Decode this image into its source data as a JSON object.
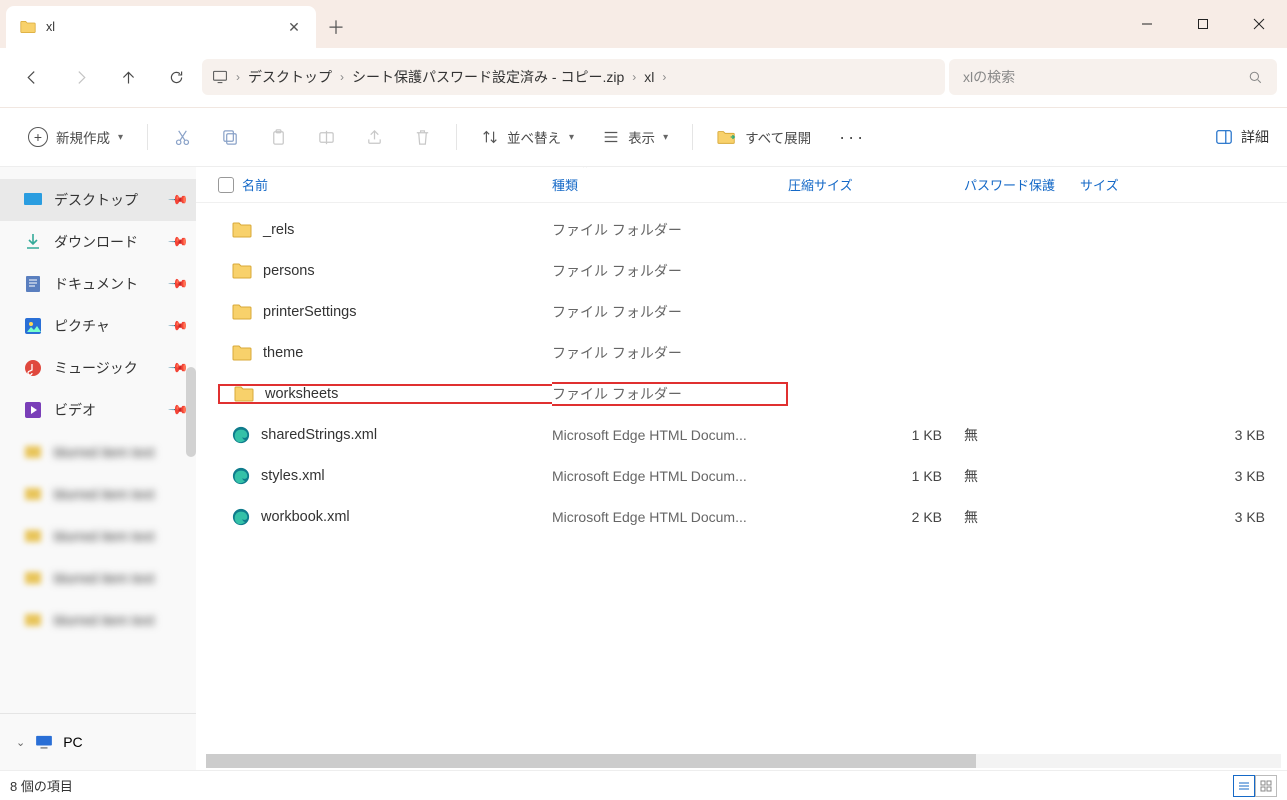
{
  "tab": {
    "title": "xl"
  },
  "breadcrumb": {
    "seg1": "デスクトップ",
    "seg2": "シート保護パスワード設定済み - コピー.zip",
    "seg3": "xl"
  },
  "search": {
    "placeholder": "xlの検索"
  },
  "toolbar": {
    "new": "新規作成",
    "sort": "並べ替え",
    "view": "表示",
    "extract_all": "すべて展開",
    "details": "詳細"
  },
  "sidebar": {
    "items": [
      {
        "label": "デスクトップ"
      },
      {
        "label": "ダウンロード"
      },
      {
        "label": "ドキュメント"
      },
      {
        "label": "ピクチャ"
      },
      {
        "label": "ミュージック"
      },
      {
        "label": "ビデオ"
      }
    ],
    "pc_label": "PC"
  },
  "columns": {
    "name": "名前",
    "type": "種類",
    "csize": "圧縮サイズ",
    "pw": "パスワード保護",
    "size": "サイズ"
  },
  "rows": [
    {
      "name": "_rels",
      "type": "ファイル フォルダー",
      "csize": "",
      "pw": "",
      "size": "",
      "icon": "folder"
    },
    {
      "name": "persons",
      "type": "ファイル フォルダー",
      "csize": "",
      "pw": "",
      "size": "",
      "icon": "folder"
    },
    {
      "name": "printerSettings",
      "type": "ファイル フォルダー",
      "csize": "",
      "pw": "",
      "size": "",
      "icon": "folder"
    },
    {
      "name": "theme",
      "type": "ファイル フォルダー",
      "csize": "",
      "pw": "",
      "size": "",
      "icon": "folder"
    },
    {
      "name": "worksheets",
      "type": "ファイル フォルダー",
      "csize": "",
      "pw": "",
      "size": "",
      "icon": "folder",
      "highlight": true
    },
    {
      "name": "sharedStrings.xml",
      "type": "Microsoft Edge HTML Docum...",
      "csize": "1 KB",
      "pw": "無",
      "size": "3 KB",
      "icon": "edge"
    },
    {
      "name": "styles.xml",
      "type": "Microsoft Edge HTML Docum...",
      "csize": "1 KB",
      "pw": "無",
      "size": "3 KB",
      "icon": "edge"
    },
    {
      "name": "workbook.xml",
      "type": "Microsoft Edge HTML Docum...",
      "csize": "2 KB",
      "pw": "無",
      "size": "3 KB",
      "icon": "edge"
    }
  ],
  "status": {
    "count": "8 個の項目"
  }
}
